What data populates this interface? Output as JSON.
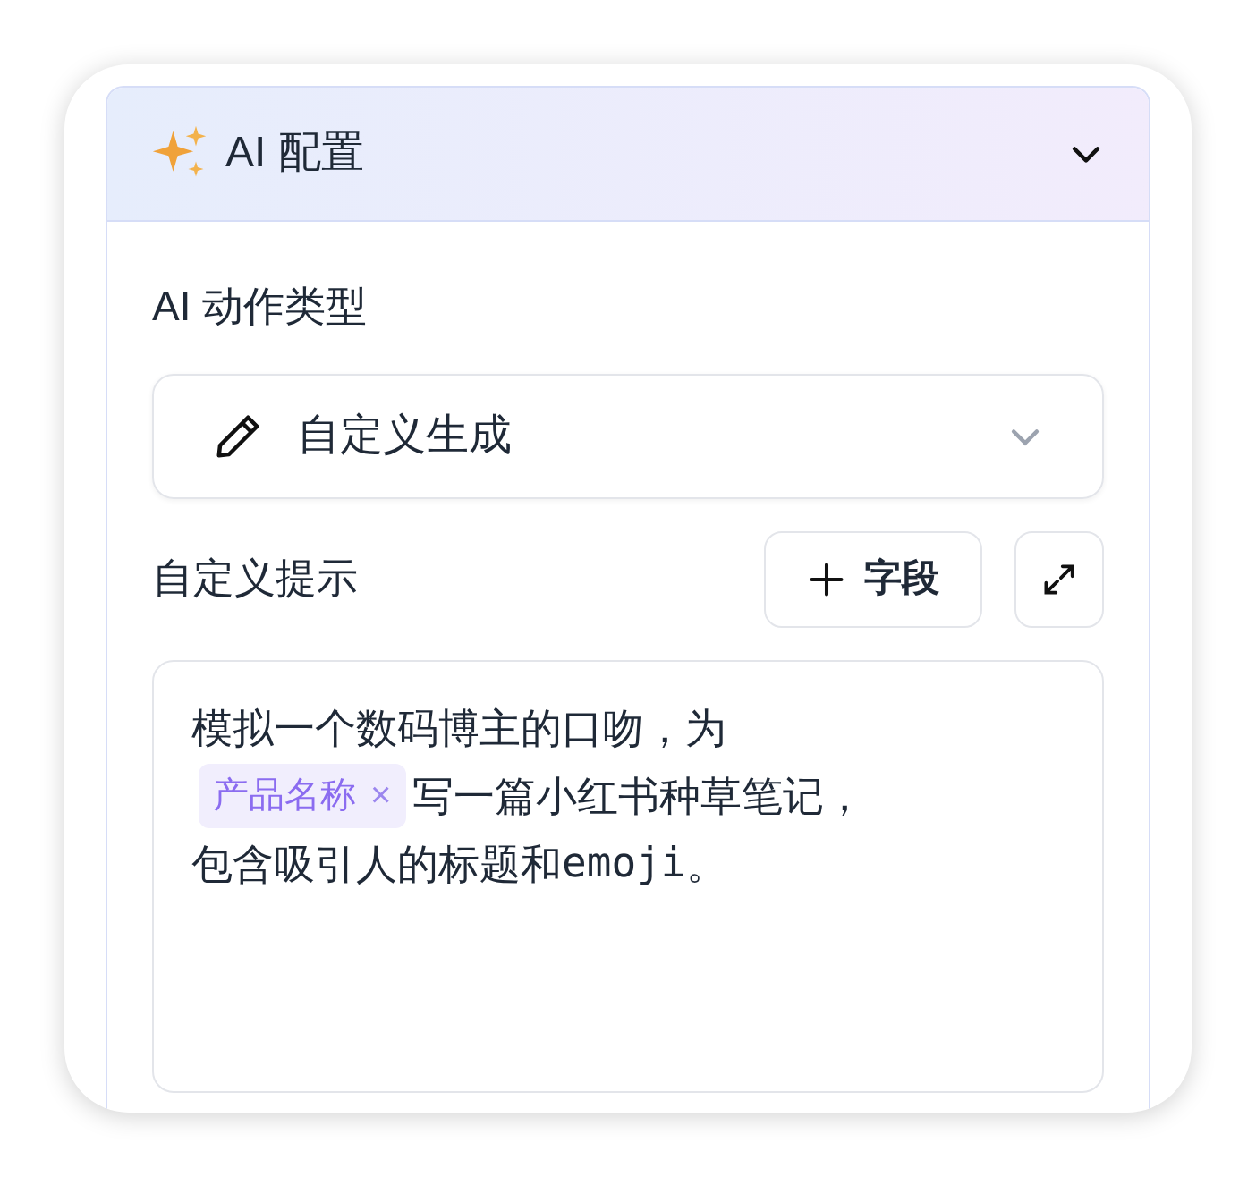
{
  "panel": {
    "title": "AI 配置",
    "expanded": true
  },
  "action_type": {
    "label": "AI 动作类型",
    "value": "自定义生成"
  },
  "custom_prompt": {
    "label": "自定义提示",
    "add_field_button": "字段",
    "lines": [
      [
        {
          "kind": "text",
          "text": "模拟一个数码博主的口吻，为"
        }
      ],
      [
        {
          "kind": "chip",
          "text": "产品名称",
          "remove": "×"
        },
        {
          "kind": "text",
          "text": "写一篇小红书种草笔记，"
        }
      ],
      [
        {
          "kind": "text",
          "text": "包含吸引人的标题和"
        },
        {
          "kind": "code",
          "text": "emoji"
        },
        {
          "kind": "text",
          "text": "。"
        }
      ]
    ]
  }
}
